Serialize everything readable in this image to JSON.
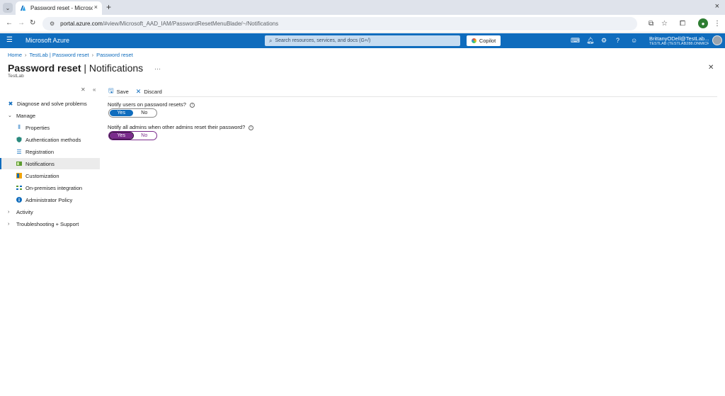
{
  "browser": {
    "tab_title": "Password reset - Microsoft Azure",
    "new_tab_symbol": "+",
    "url_host": "portal.azure.com",
    "url_path": "/#view/Microsoft_AAD_IAM/PasswordResetMenuBlade/~/Notifications"
  },
  "azure": {
    "brand": "Microsoft Azure",
    "search_placeholder": "Search resources, services, and docs (G+/)",
    "copilot_label": "Copilot",
    "account_name": "BrittanyODell@TestLab...",
    "account_tenant": "TESTLAB (TESTLAB288.ONMICRO..."
  },
  "breadcrumb": [
    "Home",
    "TestLab | Password reset",
    "Password reset"
  ],
  "page": {
    "title_main": "Password reset",
    "title_sep": " | ",
    "title_sub": "Notifications",
    "more": "···",
    "subtitle": "TestLab"
  },
  "nav": {
    "items": [
      {
        "label": "Diagnose and solve problems"
      },
      {
        "label": "Manage"
      },
      {
        "label": "Properties"
      },
      {
        "label": "Authentication methods"
      },
      {
        "label": "Registration"
      },
      {
        "label": "Notifications"
      },
      {
        "label": "Customization"
      },
      {
        "label": "On-premises integration"
      },
      {
        "label": "Administrator Policy"
      },
      {
        "label": "Activity"
      },
      {
        "label": "Troubleshooting + Support"
      }
    ]
  },
  "toolbar": {
    "save_label": "Save",
    "discard_label": "Discard"
  },
  "settings": {
    "notify_users": {
      "label": "Notify users on password resets?",
      "yes": "Yes",
      "no": "No",
      "selected": "Yes"
    },
    "notify_admins": {
      "label": "Notify all admins when other admins reset their password?",
      "yes": "Yes",
      "no": "No",
      "selected": "Yes"
    }
  },
  "colors": {
    "azure_blue": "#0f6cbd",
    "focus_purple": "#7a2b8c"
  }
}
